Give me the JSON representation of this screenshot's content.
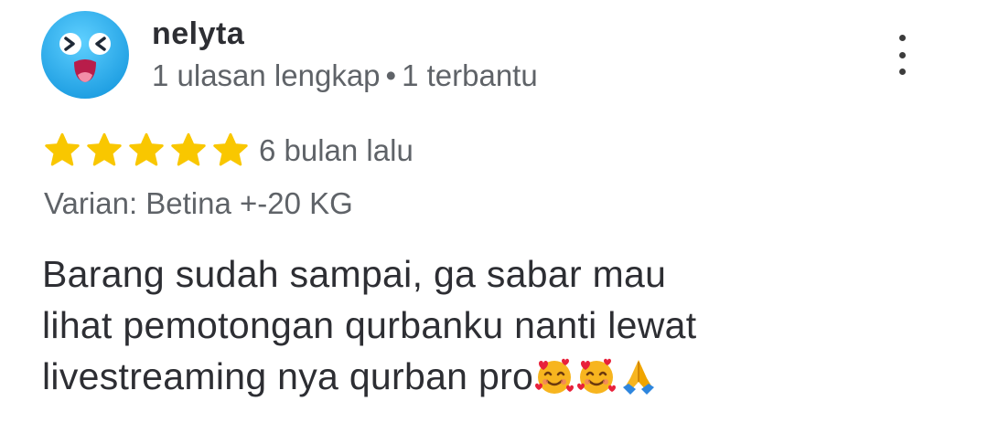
{
  "reviewer": {
    "name": "nelyta",
    "reviews_count": "1 ulasan lengkap",
    "separator": "•",
    "helpful": "1 terbantu",
    "avatar_icon": "squinting-face-avatar-icon"
  },
  "rating": {
    "stars": 5,
    "max": 5,
    "star_color": "#f9c700",
    "time_ago": "6 bulan lalu"
  },
  "variant": "Varian: Betina +-20 KG",
  "review": {
    "lines": [
      "Barang sudah sampai, ga sabar mau",
      "lihat pemotongan qurbanku nanti lewat",
      "livestreaming nya qurban pro"
    ],
    "emojis": [
      "smiling-face-with-hearts-icon",
      "smiling-face-with-hearts-icon",
      "folded-hands-icon"
    ]
  },
  "colors": {
    "avatar_bg": "#2fb2ef",
    "text_primary": "#2d2e33",
    "text_secondary": "#5f6368"
  }
}
